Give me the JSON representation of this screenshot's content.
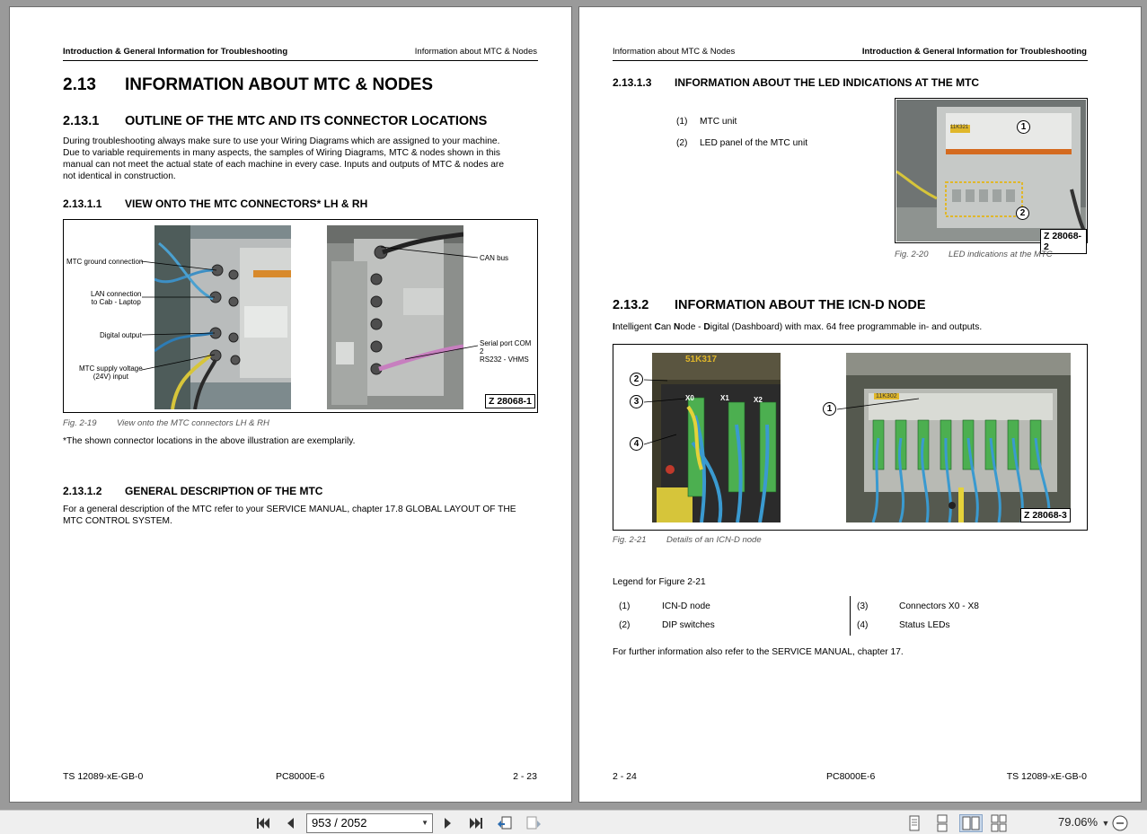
{
  "left_page": {
    "header_left": "Introduction & General Information for Troubleshooting",
    "header_right": "Information about MTC & Nodes",
    "s213_num": "2.13",
    "s213_title": "INFORMATION ABOUT MTC & NODES",
    "s2131_num": "2.13.1",
    "s2131_title": "OUTLINE OF THE MTC AND ITS CONNECTOR LOCATIONS",
    "s2131_body": [
      "During troubleshooting always make sure to use your Wiring Diagrams which are assigned to your machine.",
      "Due to variable requirements in many aspects, the samples of Wiring Diagrams, MTC & nodes shown in this",
      "manual  can not meet the actual state of each machine in every case. Inputs and outputs of MTC & nodes are",
      "not identical in construction."
    ],
    "s21311_num": "2.13.1.1",
    "s21311_title": "VIEW ONTO THE MTC CONNECTORS* LH & RH",
    "fig19": {
      "callouts": {
        "ground": "MTC ground connection",
        "lan1": "LAN connection",
        "lan2": "to Cab - Laptop",
        "digital": "Digital output",
        "supply1": "MTC supply voltage",
        "supply2": "(24V) input",
        "can": "CAN bus",
        "serial1": "Serial port COM 2",
        "serial2": "RS232 - VHMS"
      },
      "zlabel": "Z 28068-1",
      "fig_num": "Fig. 2-19",
      "fig_caption": "View onto the MTC connectors LH & RH"
    },
    "footnote": "*The shown connector locations in the above illustration are exemplarily.",
    "s21312_num": "2.13.1.2",
    "s21312_title": "GENERAL DESCRIPTION OF THE MTC",
    "s21312_body": [
      "For a general description of the MTC refer to your SERVICE MANUAL, chapter 17.8 GLOBAL LAYOUT OF THE",
      "MTC CONTROL SYSTEM."
    ],
    "footer_left": "TS 12089-xE-GB-0",
    "footer_center": "PC8000E-6",
    "footer_right": "2 - 23"
  },
  "right_page": {
    "header_left": "Information about MTC & Nodes",
    "header_right": "Introduction & General Information for Troubleshooting",
    "s21313_num": "2.13.1.3",
    "s21313_title": "INFORMATION ABOUT THE LED INDICATIONS AT THE MTC",
    "led_items": [
      {
        "num": "(1)",
        "text": "MTC unit"
      },
      {
        "num": "(2)",
        "text": "LED panel of the MTC unit"
      }
    ],
    "fig20": {
      "marker1": "1",
      "marker2": "2",
      "unit_label": "11K321",
      "zlabel": "Z 28068-2",
      "fig_num": "Fig. 2-20",
      "fig_caption": "LED indications at the MTC"
    },
    "s2132_num": "2.13.2",
    "s2132_title": "INFORMATION ABOUT THE ICN-D NODE",
    "icn_intro": [
      {
        "t": "I",
        "b": true
      },
      {
        "t": "ntelligent ",
        "b": false
      },
      {
        "t": "C",
        "b": true
      },
      {
        "t": "an ",
        "b": false
      },
      {
        "t": "N",
        "b": true
      },
      {
        "t": "ode - ",
        "b": false
      },
      {
        "t": "D",
        "b": true
      },
      {
        "t": "igital (Dashboard) with max. 64 free programmable in- and outputs.",
        "b": false
      }
    ],
    "fig21": {
      "photo_label_left": "51K317",
      "photo_label_right": "11K302",
      "x0": "X0",
      "x1": "X1",
      "x2": "X2",
      "markers": [
        "2",
        "3",
        "4",
        "1"
      ],
      "zlabel": "Z 28068-3",
      "fig_num": "Fig. 2-21",
      "fig_caption": "Details of an ICN-D node"
    },
    "legend_title": "Legend for Figure 2-21",
    "legend_left": [
      {
        "num": "(1)",
        "text": "ICN-D node"
      },
      {
        "num": "(2)",
        "text": "DIP switches"
      }
    ],
    "legend_right": [
      {
        "num": "(3)",
        "text": "Connectors X0 - X8"
      },
      {
        "num": "(4)",
        "text": "Status LEDs"
      }
    ],
    "further": "For further information also refer to the SERVICE MANUAL, chapter 17.",
    "footer_left": "2 - 24",
    "footer_center": "PC8000E-6",
    "footer_right": "TS 12089-xE-GB-0"
  },
  "toolbar": {
    "page_value": "953 / 2052",
    "zoom": "79.06%",
    "icons": [
      "first-page-icon",
      "prev-page-icon",
      "next-page-icon",
      "last-page-icon",
      "go-back-icon",
      "go-forward-icon",
      "single-page-icon",
      "continuous-icon",
      "two-page-icon",
      "facing-continuous-icon",
      "zoom-dropdown-icon",
      "zoom-out-icon"
    ]
  }
}
